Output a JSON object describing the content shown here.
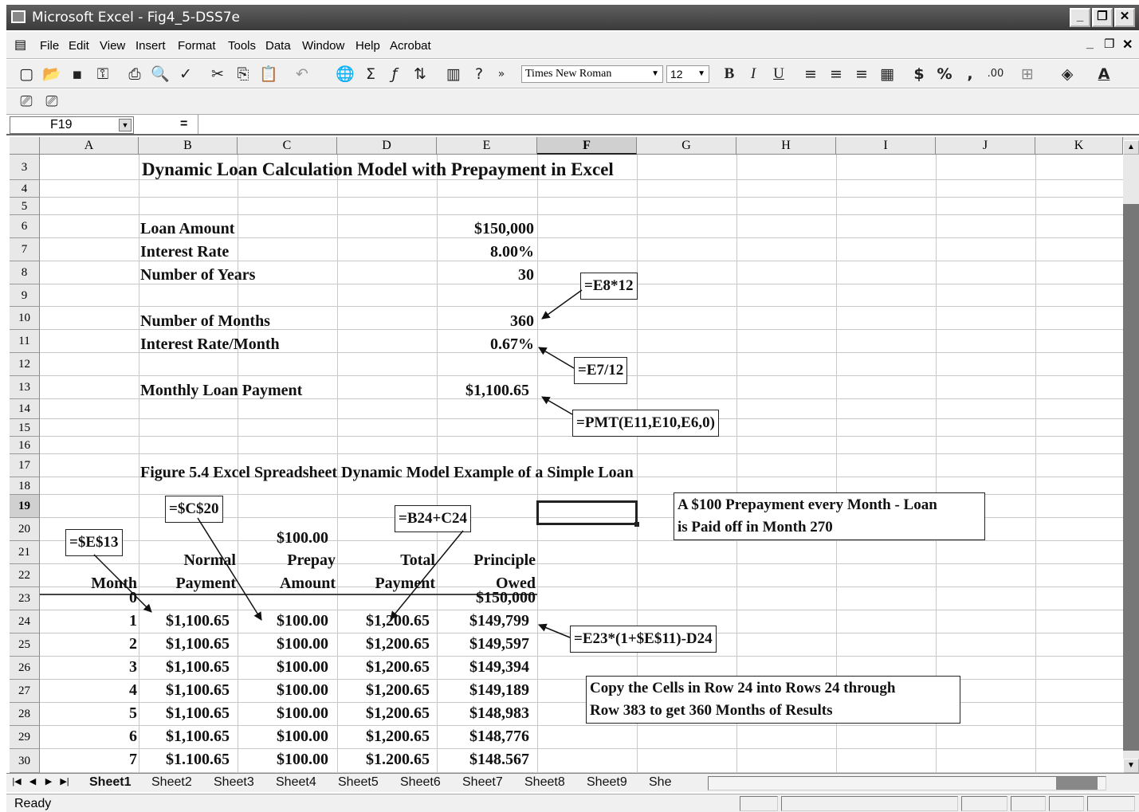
{
  "window": {
    "title": "Microsoft Excel - Fig4_5-DSS7e"
  },
  "menu": [
    "File",
    "Edit",
    "View",
    "Insert",
    "Format",
    "Tools",
    "Data",
    "Window",
    "Help",
    "Acrobat"
  ],
  "toolbar": {
    "font_name": "Times New Roman",
    "font_size": "12",
    "bold": "B",
    "italic": "I",
    "underline": "U",
    "currency": "$",
    "percent": "%",
    "comma": ",",
    "decimals": ".00"
  },
  "formula_bar": {
    "name_box": "F19",
    "equals": "=",
    "formula": ""
  },
  "columns": [
    "A",
    "B",
    "C",
    "D",
    "E",
    "F",
    "G",
    "H",
    "I",
    "J",
    "K"
  ],
  "rows": [
    "3",
    "4",
    "5",
    "6",
    "7",
    "8",
    "9",
    "10",
    "11",
    "12",
    "13",
    "14",
    "15",
    "16",
    "17",
    "18",
    "19",
    "20",
    "21",
    "22",
    "23",
    "24",
    "25",
    "26",
    "27",
    "28",
    "29",
    "30"
  ],
  "sheet": {
    "title": "Dynamic Loan Calculation Model with Prepayment in Excel",
    "inputs": [
      {
        "label": "Loan Amount",
        "value": "$150,000"
      },
      {
        "label": "Interest Rate",
        "value": "8.00%"
      },
      {
        "label": "Number of Years",
        "value": "30"
      },
      {
        "label": "Number of Months",
        "value": "360"
      },
      {
        "label": "Interest Rate/Month",
        "value": "0.67%"
      },
      {
        "label": "Monthly Loan Payment",
        "value": "$1,100.65"
      }
    ],
    "figure_caption": "Figure 5.4 Excel Spreadsheet Dynamic Model Example of a Simple Loan",
    "prepay_value": "$100.00",
    "headers": {
      "month": "Month",
      "normal_1": "Normal",
      "normal_2": "Payment",
      "prepay_1": "Prepay",
      "prepay_2": "Amount",
      "total_1": "Total",
      "total_2": "Payment",
      "principle_1": "Principle",
      "principle_2": "Owed"
    },
    "table": [
      {
        "month": "0",
        "normal": "",
        "prepay": "",
        "total": "",
        "owed": "$150,000"
      },
      {
        "month": "1",
        "normal": "$1,100.65",
        "prepay": "$100.00",
        "total": "$1,200.65",
        "owed": "$149,799"
      },
      {
        "month": "2",
        "normal": "$1,100.65",
        "prepay": "$100.00",
        "total": "$1,200.65",
        "owed": "$149,597"
      },
      {
        "month": "3",
        "normal": "$1,100.65",
        "prepay": "$100.00",
        "total": "$1,200.65",
        "owed": "$149,394"
      },
      {
        "month": "4",
        "normal": "$1,100.65",
        "prepay": "$100.00",
        "total": "$1,200.65",
        "owed": "$149,189"
      },
      {
        "month": "5",
        "normal": "$1,100.65",
        "prepay": "$100.00",
        "total": "$1,200.65",
        "owed": "$148,983"
      },
      {
        "month": "6",
        "normal": "$1,100.65",
        "prepay": "$100.00",
        "total": "$1,200.65",
        "owed": "$148,776"
      },
      {
        "month": "7",
        "normal": "$1.100.65",
        "prepay": "$100.00",
        "total": "$1.200.65",
        "owed": "$148.567"
      }
    ],
    "callouts": {
      "months": "=E8*12",
      "rate": "=E7/12",
      "pmt": "=PMT(E11,E10,E6,0)",
      "prepay_ref": "=$C$20",
      "total": "=B24+C24",
      "normal_ref": "=$E$13",
      "owed": "=E23*(1+$E$11)-D24",
      "prepay_note_1": "A $100 Prepayment every Month - Loan",
      "prepay_note_2": "is Paid off in Month 270",
      "copy_note_1": "Copy the Cells in Row 24 into Rows 24 through",
      "copy_note_2": "Row 383 to get 360 Months of Results"
    }
  },
  "tabs": [
    "Sheet1",
    "Sheet2",
    "Sheet3",
    "Sheet4",
    "Sheet5",
    "Sheet6",
    "Sheet7",
    "Sheet8",
    "Sheet9",
    "She"
  ],
  "status": "Ready"
}
